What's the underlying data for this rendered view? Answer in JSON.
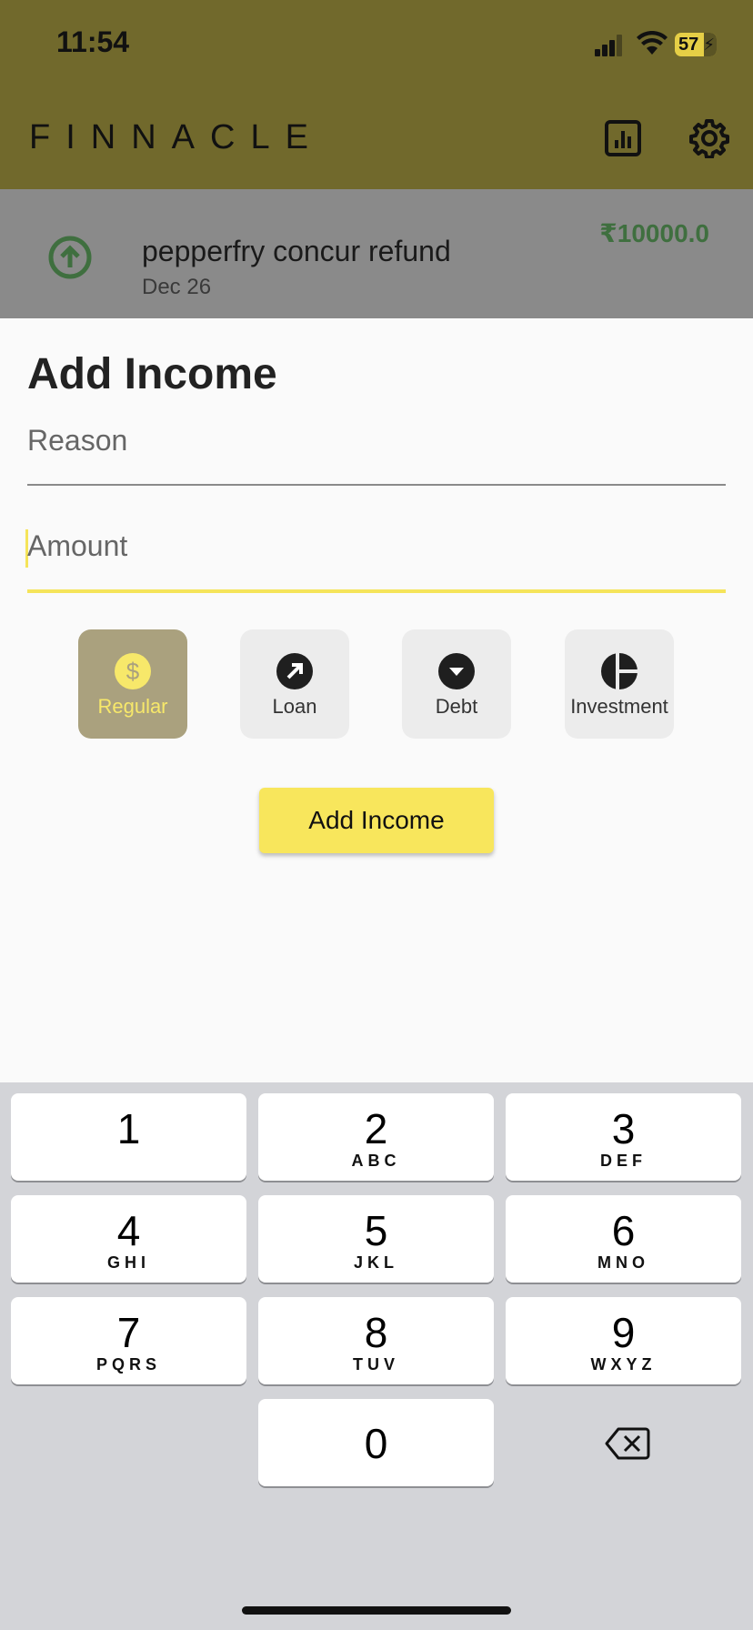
{
  "status_bar": {
    "time": "11:54",
    "battery": "57"
  },
  "header": {
    "app_title": "FINNACLE"
  },
  "transaction": {
    "title": "pepperfry concur refund",
    "date": "Dec 26",
    "amount": "₹10000.0"
  },
  "sheet": {
    "title": "Add Income",
    "reason_placeholder": "Reason",
    "amount_placeholder": "Amount",
    "categories": [
      {
        "label": "Regular",
        "icon": "dollar-icon",
        "selected": true
      },
      {
        "label": "Loan",
        "icon": "arrow-up-right-icon",
        "selected": false
      },
      {
        "label": "Debt",
        "icon": "caret-down-icon",
        "selected": false
      },
      {
        "label": "Investment",
        "icon": "pie-icon",
        "selected": false
      }
    ],
    "submit_label": "Add Income"
  },
  "keyboard": {
    "keys": [
      {
        "digit": "1",
        "letters": ""
      },
      {
        "digit": "2",
        "letters": "ABC"
      },
      {
        "digit": "3",
        "letters": "DEF"
      },
      {
        "digit": "4",
        "letters": "GHI"
      },
      {
        "digit": "5",
        "letters": "JKL"
      },
      {
        "digit": "6",
        "letters": "MNO"
      },
      {
        "digit": "7",
        "letters": "PQRS"
      },
      {
        "digit": "8",
        "letters": "TUV"
      },
      {
        "digit": "9",
        "letters": "WXYZ"
      },
      {
        "digit": "0",
        "letters": ""
      }
    ]
  },
  "colors": {
    "accent_yellow": "#f8e65c",
    "header_olive": "#71692c",
    "income_green": "#3f6f3f",
    "selected_category": "#aaa17e"
  }
}
